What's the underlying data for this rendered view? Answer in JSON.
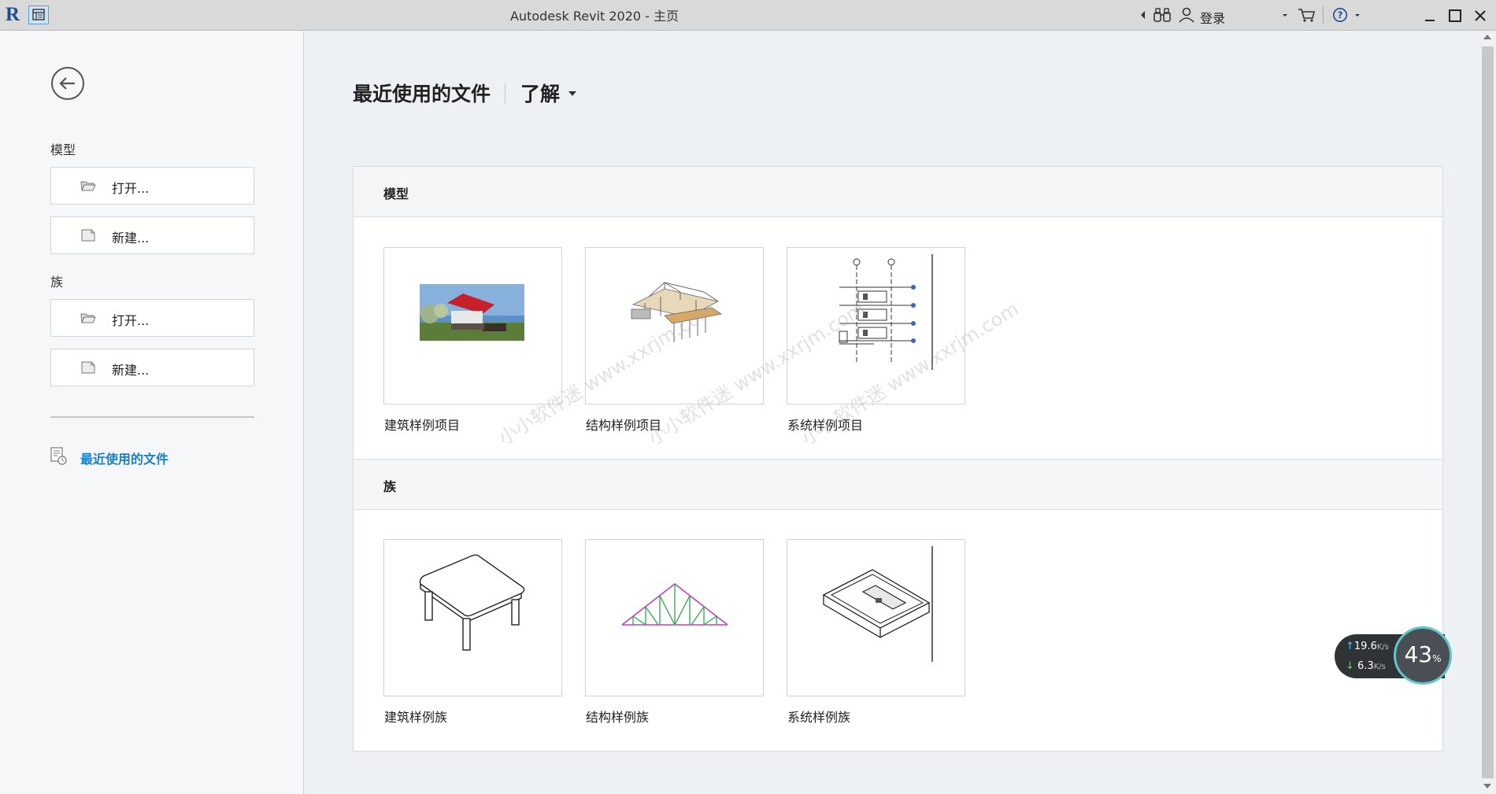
{
  "titlebar": {
    "app_icon": "revit-logo",
    "title": "Autodesk Revit 2020 - 主页",
    "signin_label": "登录",
    "icons": [
      "chevron-left-icon",
      "binoculars-icon",
      "user-icon",
      "dropdown-icon",
      "cart-icon",
      "help-icon",
      "dropdown-icon",
      "minimize-icon",
      "maximize-icon",
      "close-icon"
    ]
  },
  "sidebar": {
    "model_label": "模型",
    "model_open": "打开...",
    "model_new": "新建...",
    "family_label": "族",
    "family_open": "打开...",
    "family_new": "新建...",
    "recent_label": "最近使用的文件"
  },
  "main": {
    "tab_recent": "最近使用的文件",
    "tab_learn": "了解",
    "sections": [
      {
        "label": "模型",
        "items": [
          {
            "caption": "建筑样例项目"
          },
          {
            "caption": "结构样例项目"
          },
          {
            "caption": "系统样例项目"
          }
        ]
      },
      {
        "label": "族",
        "items": [
          {
            "caption": "建筑样例族"
          },
          {
            "caption": "结构样例族"
          },
          {
            "caption": "系统样例族"
          }
        ]
      }
    ]
  },
  "watermark": "小小软件迷 www.xxrjm.com",
  "net_widget": {
    "upload": "19.6",
    "download": "6.3",
    "unit": "K/s",
    "percent": "43",
    "percent_sign": "%"
  },
  "colors": {
    "accent": "#1a7ec4",
    "titlebar": "#d9d9d9",
    "left_panel": "#f5f7f9",
    "main_bg": "#eef1f4"
  }
}
